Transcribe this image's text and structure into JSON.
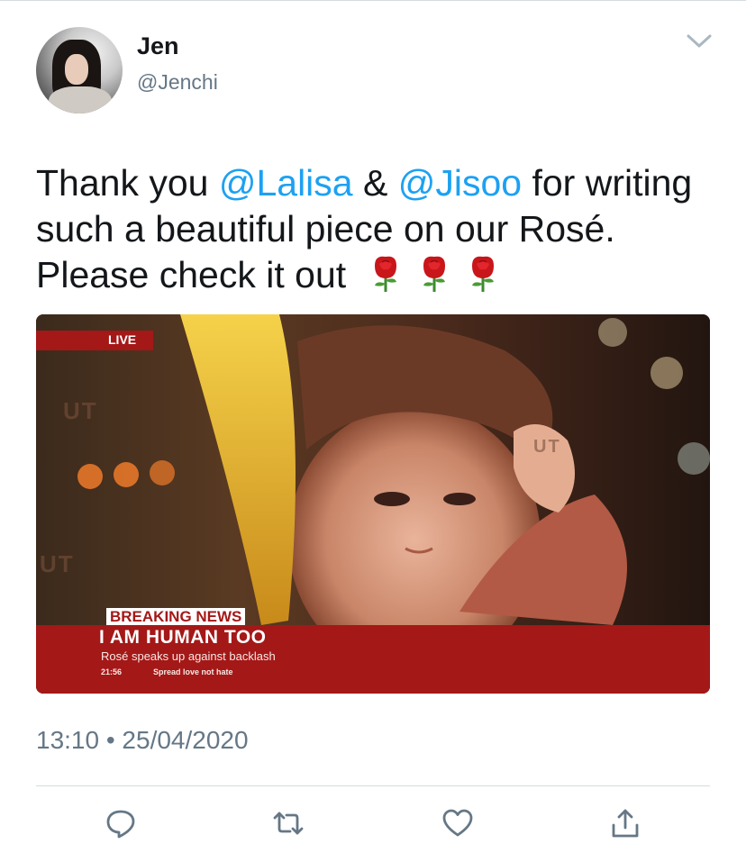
{
  "author": {
    "name": "Jen",
    "handle": "@Jenchi"
  },
  "tweet": {
    "text_part1": "Thank you ",
    "mention1": "@Lalisa",
    "text_part2": " & ",
    "mention2": "@Jisoo",
    "text_part3": " for writing such a beautiful piece on our Rosé. Please check it out",
    "emoji": [
      "rose-emoji",
      "rose-emoji",
      "rose-emoji"
    ]
  },
  "media": {
    "live_label": "LIVE",
    "bg_text_1": "UT",
    "bg_text_2": "UT",
    "bg_text_3": "UT",
    "breaking_label": "BREAKING NEWS",
    "headline": "I AM HUMAN TOO",
    "subline": "Rosé speaks up against backlash",
    "clock": "21:56",
    "ticker": "Spread love not hate"
  },
  "meta": {
    "timestamp": "13:10 • 25/04/2020"
  },
  "actions": [
    "reply-icon",
    "retweet-icon",
    "like-icon",
    "share-icon"
  ],
  "colors": {
    "link": "#1da1f2",
    "muted": "#657786",
    "news_red": "#a41818"
  }
}
